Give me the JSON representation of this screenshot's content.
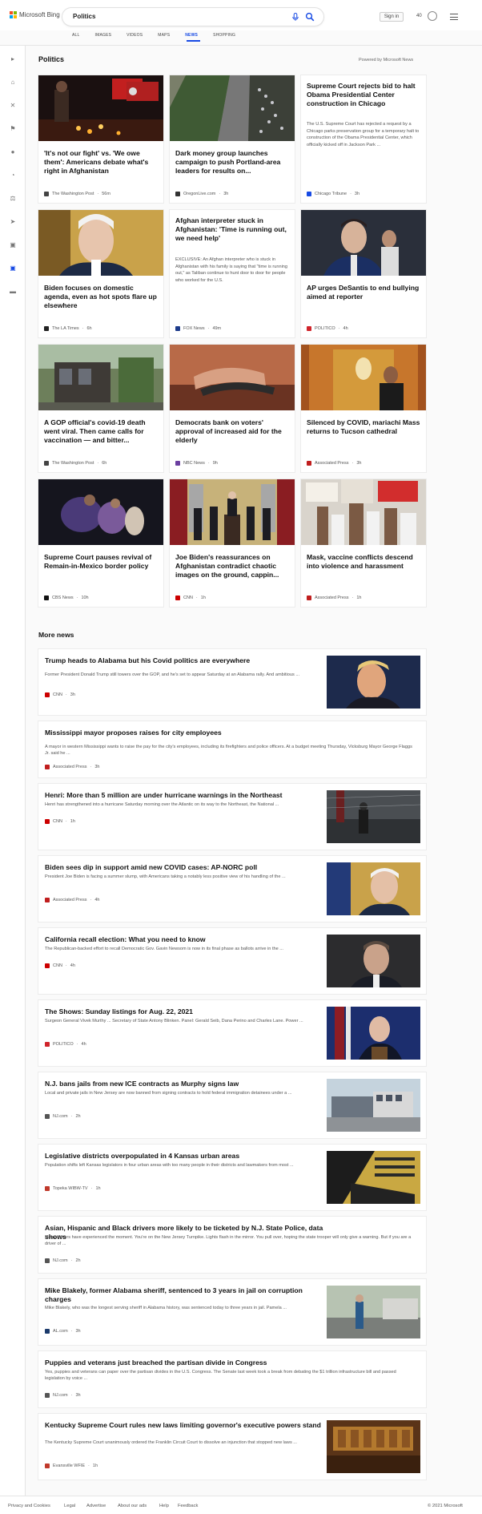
{
  "header": {
    "brand": "Microsoft Bing",
    "query": "Politics",
    "signin": "Sign in",
    "points": "40"
  },
  "tabs": [
    "ALL",
    "IMAGES",
    "VIDEOS",
    "MAPS",
    "NEWS",
    "SHOPPING"
  ],
  "section": {
    "title": "Politics",
    "powered": "Powered by Microsoft News"
  },
  "cards": [
    {
      "title": "'It's not our fight' vs. 'We owe them': Americans debate what's right in Afghanistan",
      "source": "The Washington Post",
      "time": "56m"
    },
    {
      "title": "Dark money group launches campaign to push Portland-area leaders for results on...",
      "source": "OregonLive.com",
      "time": "3h"
    },
    {
      "title": "Supreme Court rejects bid to halt Obama Presidential Center construction in Chicago",
      "desc": "The U.S. Supreme Court has rejected a request by a Chicago parks preservation group for a temporary halt to construction of the Obama Presidential Center, which officially kicked off in Jackson Park ...",
      "source": "Chicago Tribune",
      "time": "3h"
    },
    {
      "title": "Biden focuses on domestic agenda, even as hot spots flare up elsewhere",
      "source": "The LA Times",
      "time": "6h"
    },
    {
      "title": "Afghan interpreter stuck in Afghanistan: 'Time is running out, we need help'",
      "desc": "EXCLUSIVE: An Afghan interpreter who is stuck in Afghanistan with his family is saying that \"time is running out,\" as Taliban continue to hunt door to door for people who worked for the U.S.",
      "source": "FOX News",
      "time": "49m"
    },
    {
      "title": "AP urges DeSantis to end bullying aimed at reporter",
      "source": "POLITICO",
      "time": "4h"
    },
    {
      "title": "A GOP official's covid-19 death went viral. Then came calls for vaccination — and bitter...",
      "source": "The Washington Post",
      "time": "6h"
    },
    {
      "title": "Democrats bank on voters' approval of increased aid for the elderly",
      "source": "NBC News",
      "time": "9h"
    },
    {
      "title": "Silenced by COVID, mariachi Mass returns to Tucson cathedral",
      "source": "Associated Press",
      "time": "3h"
    },
    {
      "title": "Supreme Court pauses revival of Remain-in-Mexico border policy",
      "source": "CBS News",
      "time": "10h"
    },
    {
      "title": "Joe Biden's reassurances on Afghanistan contradict chaotic images on the ground, cappin...",
      "source": "CNN",
      "time": "1h"
    },
    {
      "title": "Mask, vaccine conflicts descend into violence and harassment",
      "source": "Associated Press",
      "time": "1h"
    }
  ],
  "more": {
    "title": "More news",
    "items": [
      {
        "title": "Trump heads to Alabama but his Covid politics are everywhere",
        "desc": "Former President Donald Trump still towers over the GOP, and he's set to appear Saturday at an Alabama rally. And ambitious ...",
        "source": "CNN",
        "time": "3h"
      },
      {
        "title": "Mississippi mayor proposes raises for city employees",
        "desc": "A mayor in western Mississippi wants to raise the pay for the city's employees, including its firefighters and police officers. At a budget meeting Thursday, Vicksburg Mayor George Flaggs Jr. said he ...",
        "source": "Associated Press",
        "time": "3h"
      },
      {
        "title": "Henri: More than 5 million are under hurricane warnings in the Northeast",
        "desc": "Henri has strengthened into a hurricane Saturday morning over the Atlantic on its way to the Northeast, the National ...",
        "source": "CNN",
        "time": "1h"
      },
      {
        "title": "Biden sees dip in support amid new COVID cases: AP-NORC poll",
        "desc": "President Joe Biden is facing a summer slump, with Americans taking a notably less positive view of his handling of the ...",
        "source": "Associated Press",
        "time": "4h"
      },
      {
        "title": "California recall election: What you need to know",
        "desc": "The Republican-backed effort to recall Democratic Gov. Gavin Newsom is now in its final phase as ballots arrive in the ...",
        "source": "CNN",
        "time": "4h"
      },
      {
        "title": "The Shows: Sunday listings for Aug. 22, 2021",
        "desc": "Surgeon General Vivek Murthy ... Secretary of State Antony Blinken. Panel: Gerald Seib, Dana Perino and Charles Lane. Power ...",
        "source": "POLITICO",
        "time": "4h"
      },
      {
        "title": "N.J. bans jails from new ICE contracts as Murphy signs law",
        "desc": "Local and private jails in New Jersey are now banned from signing contracts to hold federal immigration detainees under a ...",
        "source": "NJ.com",
        "time": "2h"
      },
      {
        "title": "Legislative districts overpopulated in 4 Kansas urban areas",
        "desc": "Population shifts left Kansas legislators in four urban areas with too many people in their districts and lawmakers from most ...",
        "source": "Topeka WIBW-TV",
        "time": "1h"
      },
      {
        "title": "Asian, Hispanic and Black drivers more likely to be ticketed by N.J. State Police, data shows",
        "desc": "Many drivers have experienced the moment. You're on the New Jersey Turnpike. Lights flash in the mirror. You pull over, hoping the state trooper will only give a warning. But if you are a driver of ...",
        "source": "NJ.com",
        "time": "2h"
      },
      {
        "title": "Mike Blakely, former Alabama sheriff, sentenced to 3 years in jail on corruption charges",
        "desc": "Mike Blakely, who was the longest serving sheriff in Alabama history, was sentenced today to three years in jail. Pamela ...",
        "source": "AL.com",
        "time": "3h"
      },
      {
        "title": "Puppies and veterans just breached the partisan divide in Congress",
        "desc": "Yes, puppies and veterans can paper over the partisan divides in the U.S. Congress. The Senate last week took a break from debating the $1 trillion infrastructure bill and passed legislation by voice ...",
        "source": "NJ.com",
        "time": "3h"
      },
      {
        "title": "Kentucky Supreme Court rules new laws limiting governor's executive powers stand",
        "desc": "The Kentucky Supreme Court unanimously ordered the Franklin Circuit Court to dissolve an injunction that stopped new laws ...",
        "source": "Evansville WFIE",
        "time": "1h"
      }
    ]
  },
  "footer": {
    "privacy": "Privacy and Cookies",
    "legal": "Legal",
    "advertise": "Advertise",
    "ads": "About our ads",
    "help": "Help",
    "feedback": "Feedback",
    "copyright": "© 2021 Microsoft"
  }
}
